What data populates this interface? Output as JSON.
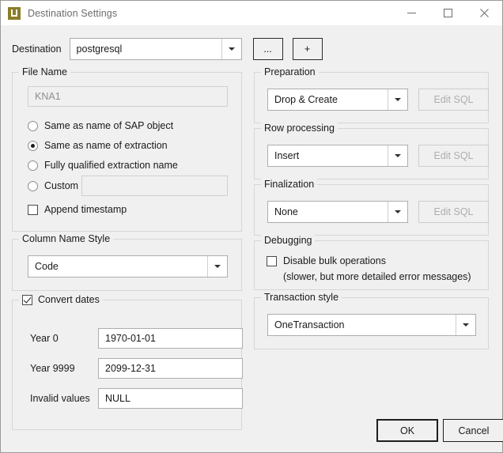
{
  "window": {
    "title": "Destination Settings",
    "icon": "app-u-icon",
    "controls": {
      "minimize": "minimize-icon",
      "maximize": "maximize-icon",
      "close": "close-icon"
    }
  },
  "destination": {
    "label": "Destination",
    "value": "postgresql",
    "browse_label": "...",
    "add_label": "+"
  },
  "file_name": {
    "title": "File Name",
    "value": "KNA1",
    "options": [
      {
        "label": "Same as name of SAP object",
        "selected": false
      },
      {
        "label": "Same as name of extraction",
        "selected": true
      },
      {
        "label": "Fully qualified extraction name",
        "selected": false
      },
      {
        "label": "Custom",
        "selected": false
      }
    ],
    "custom_value": "",
    "append_timestamp": {
      "label": "Append timestamp",
      "checked": false
    }
  },
  "column_name_style": {
    "title": "Column Name Style",
    "value": "Code"
  },
  "convert_dates": {
    "title": "Convert dates",
    "checked": true,
    "fields": [
      {
        "label": "Year 0",
        "value": "1970-01-01"
      },
      {
        "label": "Year 9999",
        "value": "2099-12-31"
      },
      {
        "label": "Invalid values",
        "value": "NULL"
      }
    ]
  },
  "preparation": {
    "title": "Preparation",
    "value": "Drop & Create",
    "edit_sql_label": "Edit SQL"
  },
  "row_processing": {
    "title": "Row processing",
    "value": "Insert",
    "edit_sql_label": "Edit SQL"
  },
  "finalization": {
    "title": "Finalization",
    "value": "None",
    "edit_sql_label": "Edit SQL"
  },
  "debugging": {
    "title": "Debugging",
    "checkbox_label": "Disable bulk operations",
    "checked": false,
    "hint": "(slower, but more detailed error messages)"
  },
  "transaction_style": {
    "title": "Transaction style",
    "value": "OneTransaction"
  },
  "footer": {
    "ok_label": "OK",
    "cancel_label": "Cancel"
  },
  "colors": {
    "window_background": "#f0f0f0",
    "titlebar_background": "#ffffff",
    "app_icon": "#8a7d28",
    "group_border": "#d6d6d6",
    "input_border": "#adadad",
    "disabled_text": "#aeaeae",
    "title_text": "#6b6b6b"
  }
}
